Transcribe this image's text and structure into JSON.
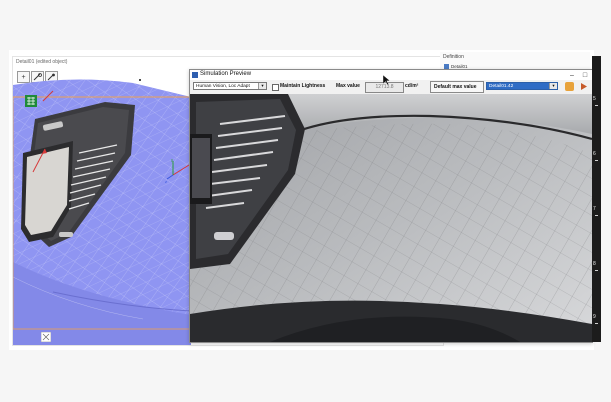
{
  "viewport": {
    "title": "Detail01 (edited object)",
    "toolbar": [
      {
        "name": "add-view-button",
        "glyph": "+"
      },
      {
        "name": "measure-tool-button",
        "glyph": "⚲"
      },
      {
        "name": "probe-tool-button",
        "glyph": "⚲"
      }
    ]
  },
  "side_panel": {
    "label": "Definition",
    "item": "Detail01"
  },
  "sim": {
    "title": "Simulation Preview",
    "mode": "Human Vision, Loc Adapt",
    "maintain_lightness": "Maintain Lightness",
    "max_value_label": "Max value",
    "max_value": "12713.8",
    "unit": "cd/m²",
    "default_max_label": "Default max value",
    "detail_select": "Detail01.42"
  },
  "ruler": {
    "labels": [
      "5",
      "6",
      "7",
      "8",
      "9"
    ]
  },
  "colors": {
    "cad_surface": "#8f95f2",
    "highlight": "#f2a24a",
    "selection": "#2f6cc5"
  }
}
